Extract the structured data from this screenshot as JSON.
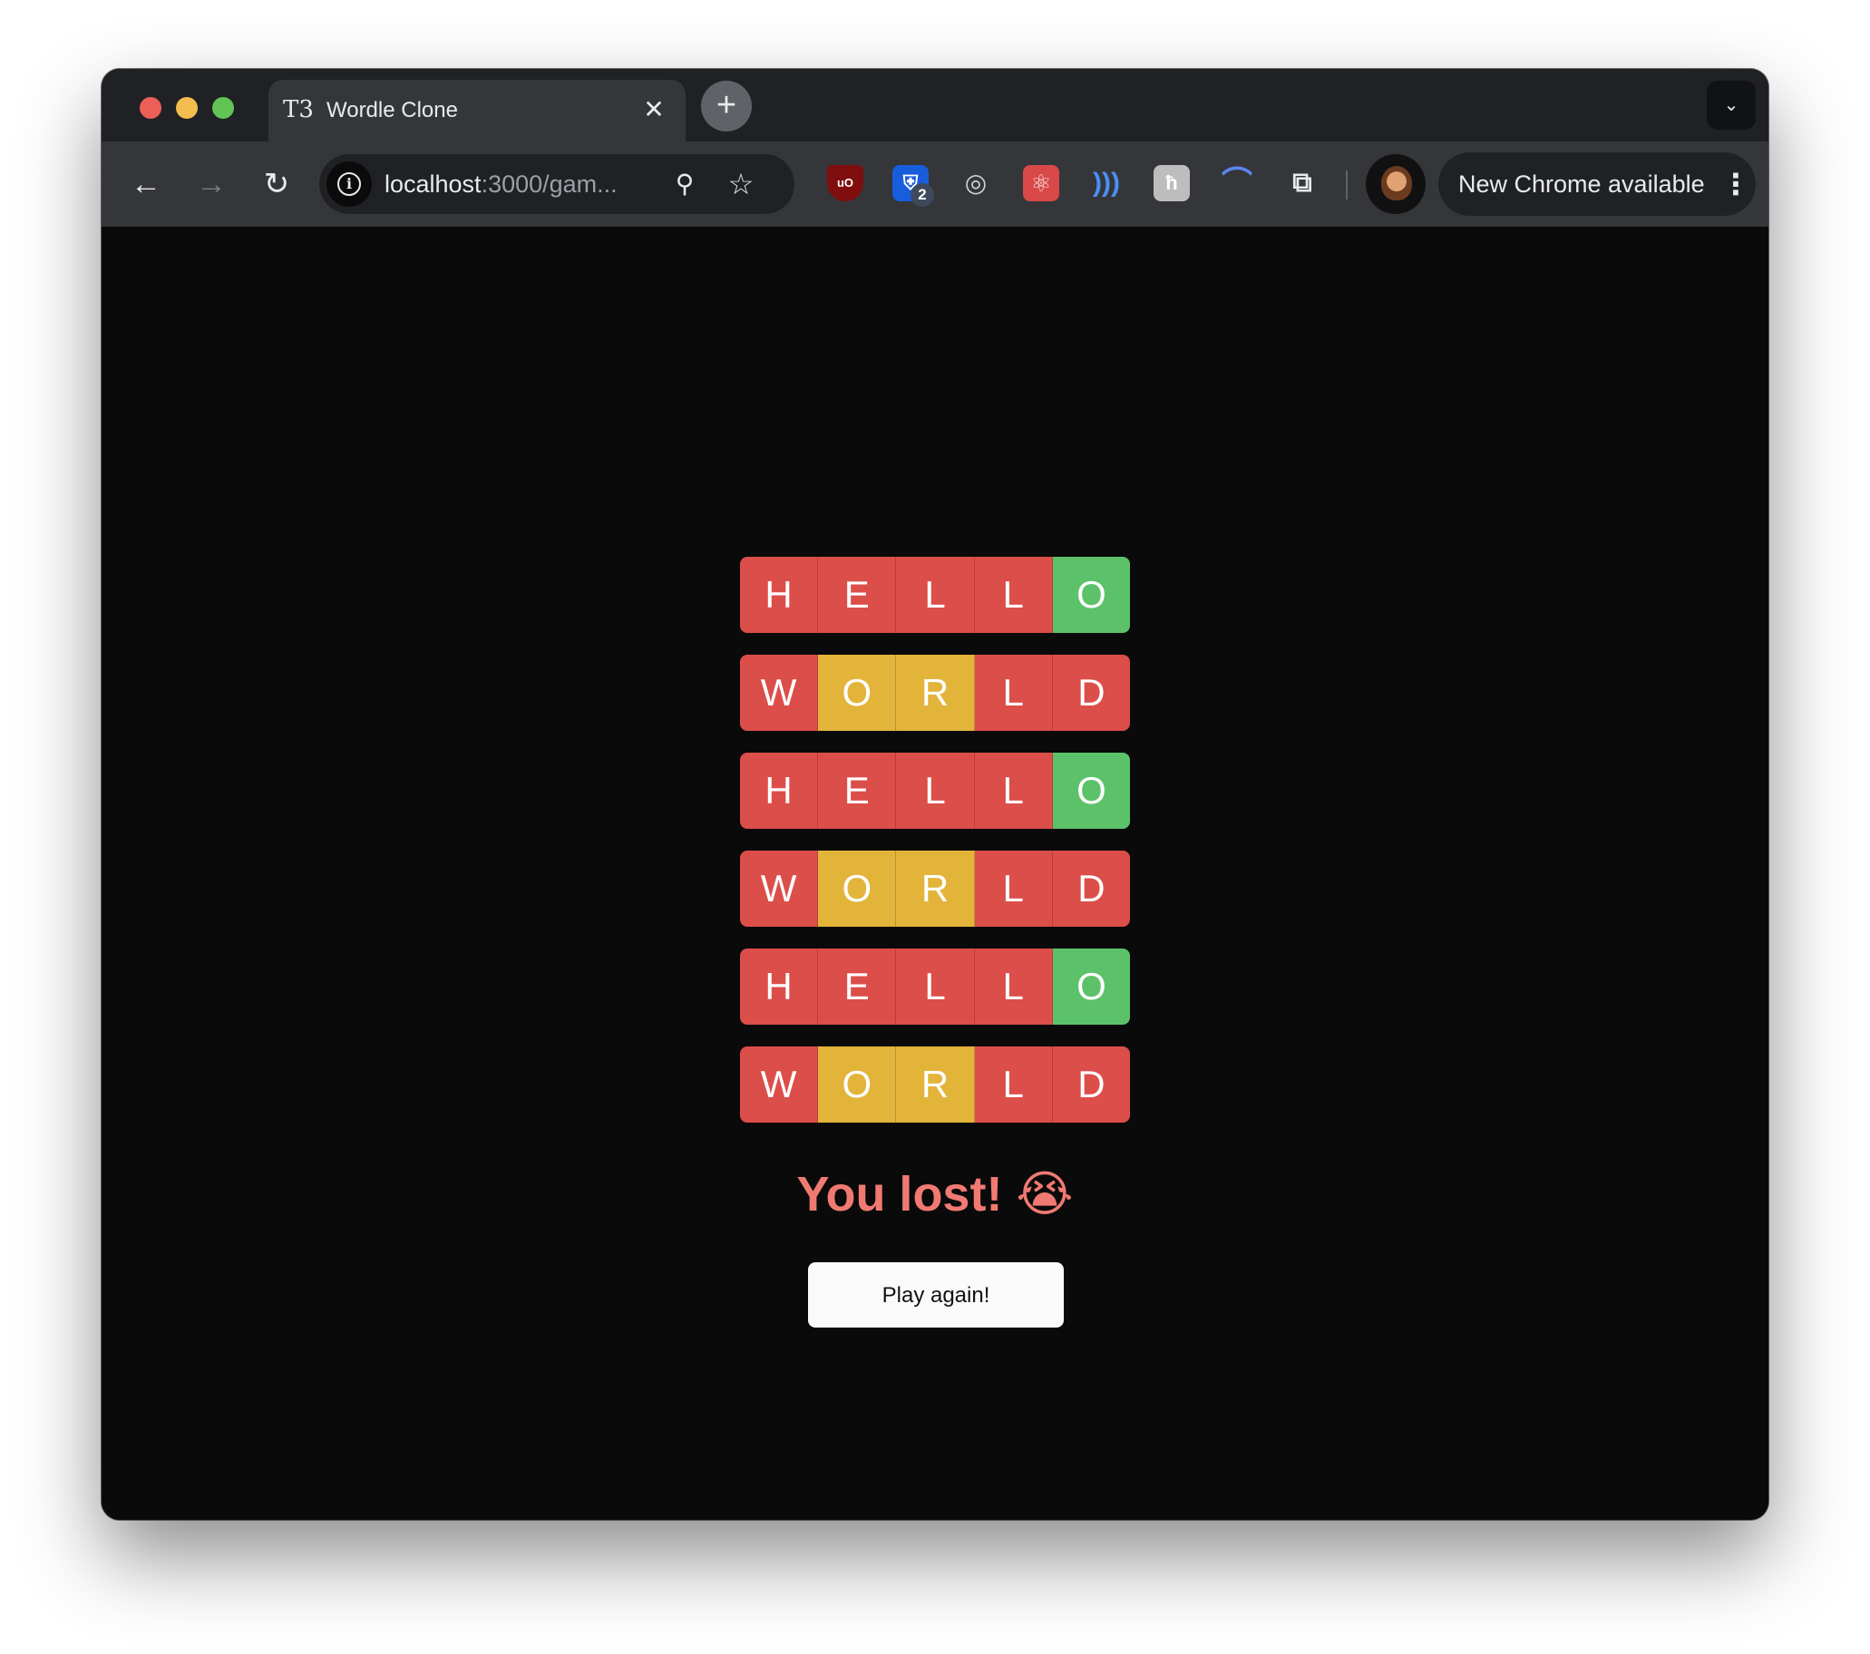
{
  "browser": {
    "tab": {
      "icon": "t3-logo-icon",
      "icon_glyph": "T3",
      "title": "Wordle Clone",
      "close_glyph": "✕"
    },
    "new_tab_glyph": "+",
    "tab_search_glyph": "⌄",
    "nav": {
      "back_glyph": "←",
      "forward_glyph": "→",
      "reload_glyph": "↻"
    },
    "address": {
      "host": "localhost",
      "path": ":3000/gam..."
    },
    "extensions_badge": "2",
    "update_label": "New Chrome available",
    "menu_glyph": "⋮"
  },
  "game": {
    "rows": [
      [
        {
          "letter": "H",
          "state": "miss"
        },
        {
          "letter": "E",
          "state": "miss"
        },
        {
          "letter": "L",
          "state": "miss"
        },
        {
          "letter": "L",
          "state": "miss"
        },
        {
          "letter": "O",
          "state": "correct"
        }
      ],
      [
        {
          "letter": "W",
          "state": "miss"
        },
        {
          "letter": "O",
          "state": "present"
        },
        {
          "letter": "R",
          "state": "present"
        },
        {
          "letter": "L",
          "state": "miss"
        },
        {
          "letter": "D",
          "state": "miss"
        }
      ],
      [
        {
          "letter": "H",
          "state": "miss"
        },
        {
          "letter": "E",
          "state": "miss"
        },
        {
          "letter": "L",
          "state": "miss"
        },
        {
          "letter": "L",
          "state": "miss"
        },
        {
          "letter": "O",
          "state": "correct"
        }
      ],
      [
        {
          "letter": "W",
          "state": "miss"
        },
        {
          "letter": "O",
          "state": "present"
        },
        {
          "letter": "R",
          "state": "present"
        },
        {
          "letter": "L",
          "state": "miss"
        },
        {
          "letter": "D",
          "state": "miss"
        }
      ],
      [
        {
          "letter": "H",
          "state": "miss"
        },
        {
          "letter": "E",
          "state": "miss"
        },
        {
          "letter": "L",
          "state": "miss"
        },
        {
          "letter": "L",
          "state": "miss"
        },
        {
          "letter": "O",
          "state": "correct"
        }
      ],
      [
        {
          "letter": "W",
          "state": "miss"
        },
        {
          "letter": "O",
          "state": "present"
        },
        {
          "letter": "R",
          "state": "present"
        },
        {
          "letter": "L",
          "state": "miss"
        },
        {
          "letter": "D",
          "state": "miss"
        }
      ]
    ],
    "result_text": "You lost! 😭",
    "play_again_label": "Play again!"
  },
  "colors": {
    "miss": "#dc4e4a",
    "present": "#e2b43a",
    "correct": "#5cc26a",
    "result": "#f07a72",
    "page_bg": "#0a0a0a"
  }
}
